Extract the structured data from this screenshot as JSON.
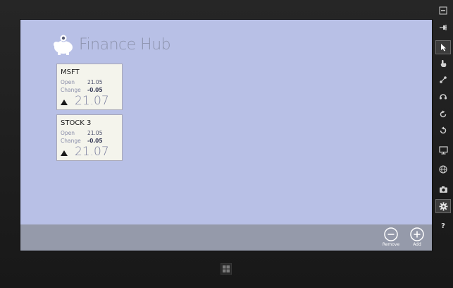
{
  "app": {
    "title": "Finance Hub"
  },
  "stocks": [
    {
      "name": "MSFT",
      "open_label": "Open",
      "open_value": "21.05",
      "change_label": "Change",
      "change_value": "-0.05",
      "price": "21.07",
      "trend_icon": "triangle-up-icon"
    },
    {
      "name": "STOCK 3",
      "open_label": "Open",
      "open_value": "21.05",
      "change_label": "Change",
      "change_value": "-0.05",
      "price": "21.07",
      "trend_icon": "triangle-up-icon"
    }
  ],
  "appbar": {
    "remove_label": "Remove",
    "add_label": "Add"
  },
  "simulator_toolbar": {
    "help_label": "?",
    "icons": [
      "minimize-icon",
      "pin-icon",
      "pointer-icon",
      "touch-icon",
      "pinch-zoom-icon",
      "rotate-touch-icon",
      "rotate-clockwise-icon",
      "rotate-counterclockwise-icon",
      "monitor-icon",
      "globe-icon",
      "camera-icon",
      "settings-icon",
      "help-icon"
    ]
  },
  "colors": {
    "screen_background": "#b8c0e6",
    "appbar_background": "#959aaa",
    "tile_background": "#f4f4ec",
    "title_text": "#8d93ad"
  }
}
